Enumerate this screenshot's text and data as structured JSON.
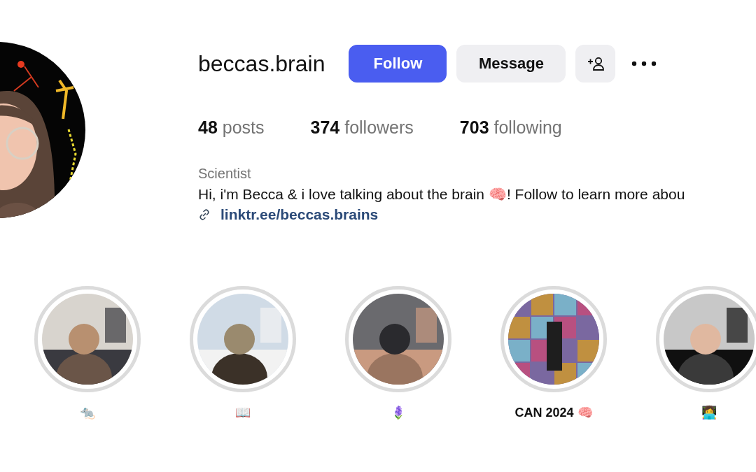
{
  "profile": {
    "username": "beccas.brain",
    "buttons": [
      {
        "kind": "primary",
        "label": "Follow"
      },
      {
        "kind": "secondary",
        "label": "Message"
      }
    ],
    "stats": [
      {
        "count": "48",
        "label": "posts"
      },
      {
        "count": "374",
        "label": "followers"
      },
      {
        "count": "703",
        "label": "following"
      }
    ],
    "category": "Scientist",
    "bio": "Hi, i'm Becca & i love talking about the brain 🧠! Follow to learn more abou",
    "link": "linktr.ee/beccas.brains"
  },
  "highlights": [
    {
      "label": "🐀"
    },
    {
      "label": "📖"
    },
    {
      "label": "🪻"
    },
    {
      "label": "CAN 2024 🧠"
    },
    {
      "label": "👩‍💻"
    }
  ]
}
